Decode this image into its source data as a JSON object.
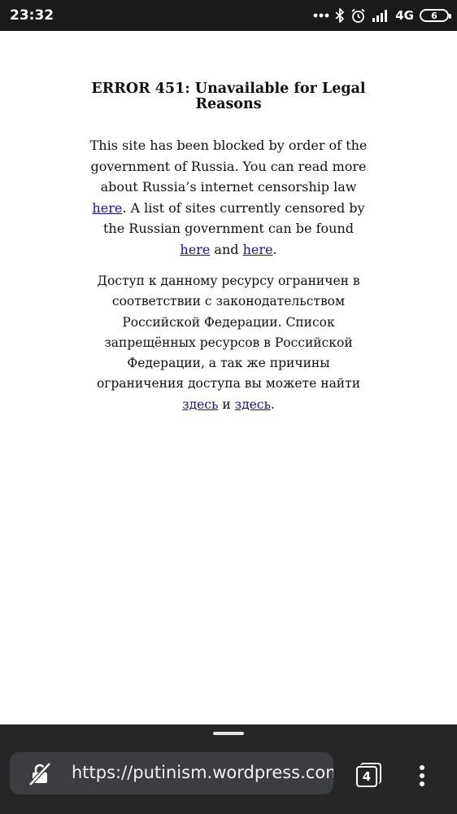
{
  "status_bar": {
    "time": "23:32",
    "network": "4G",
    "battery": "6",
    "icons": [
      "more-dots-icon",
      "bluetooth-icon",
      "alarm-icon",
      "signal-icon",
      "battery-icon"
    ]
  },
  "page": {
    "title": "ERROR 451: Unavailable for Legal Reasons",
    "english": {
      "text1": "This site has been blocked by order of the government of Russia. You can read more about Russia’s internet censorship law ",
      "link1": "here",
      "text2": ". A list of sites currently censored by the Russian government can be found ",
      "link2": "here",
      "text3": " and ",
      "link3": "here",
      "text4": "."
    },
    "russian": {
      "text1": "Доступ к данному ресурсу ограничен в соответствии с законодательством Российской Федерации. Список запрещённых ресурсов в Российской Федерации, а так же причины ограничения доступа вы можете найти ",
      "link1": "здесь",
      "text2": " и ",
      "link2": "здесь",
      "text3": "."
    }
  },
  "browser": {
    "url": "https://putinism.wordpress.com",
    "tab_count": "4",
    "colors": {
      "bar": "#262626",
      "url_box": "#3c3d40",
      "link": "#1a0dab"
    }
  }
}
